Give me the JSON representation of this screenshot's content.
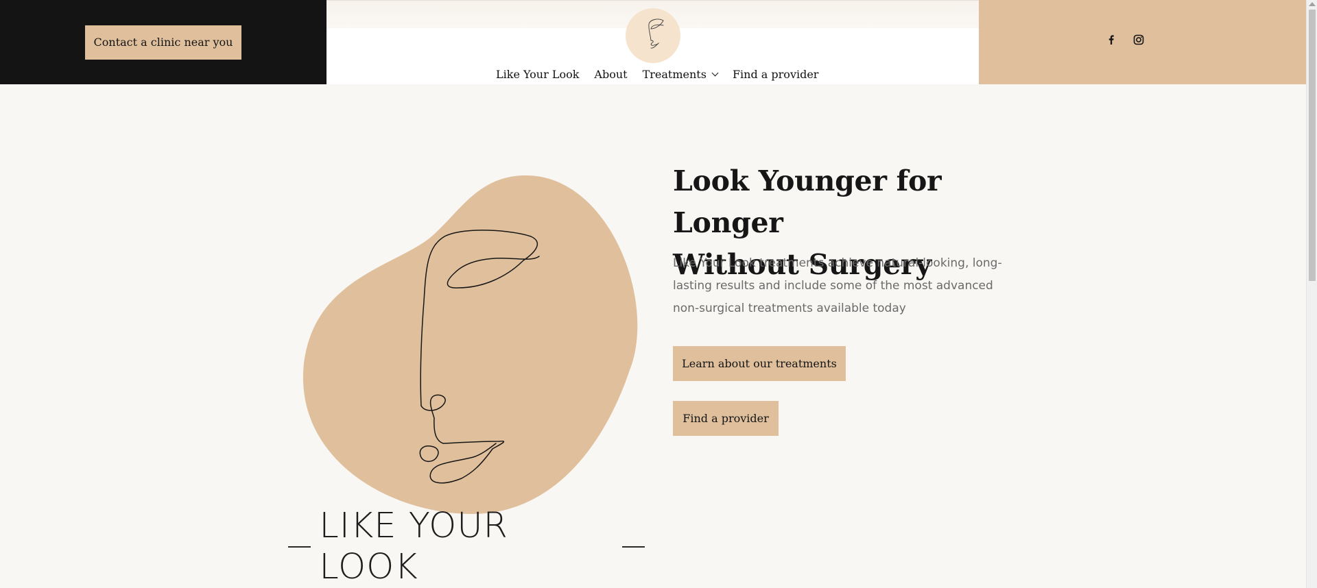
{
  "header": {
    "contact_button": "Contact a clinic near you",
    "logo_icon": "face-line-art-icon",
    "nav": [
      {
        "label": "Like Your Look"
      },
      {
        "label": "About"
      },
      {
        "label": "Treatments",
        "has_dropdown": true
      },
      {
        "label": "Find a provider"
      }
    ],
    "social": [
      {
        "icon": "facebook-icon"
      },
      {
        "icon": "instagram-icon"
      }
    ]
  },
  "hero": {
    "headline_line1": "Look Younger for Longer",
    "headline_line2": "Without Surgery",
    "lead": "Like Your Look treatments achieve natural-looking, long-lasting results and include some of the most advanced non-surgical treatments available today",
    "learn_button": "Learn about our treatments",
    "find_button": "Find a provider",
    "brand_text": "LIKE YOUR LOOK",
    "art_icon": "face-line-art-icon"
  },
  "colors": {
    "accent": "#e0c09c",
    "dark": "#141414",
    "page_bg": "#f9f7f3",
    "logo_bg": "#f5e3ce"
  }
}
